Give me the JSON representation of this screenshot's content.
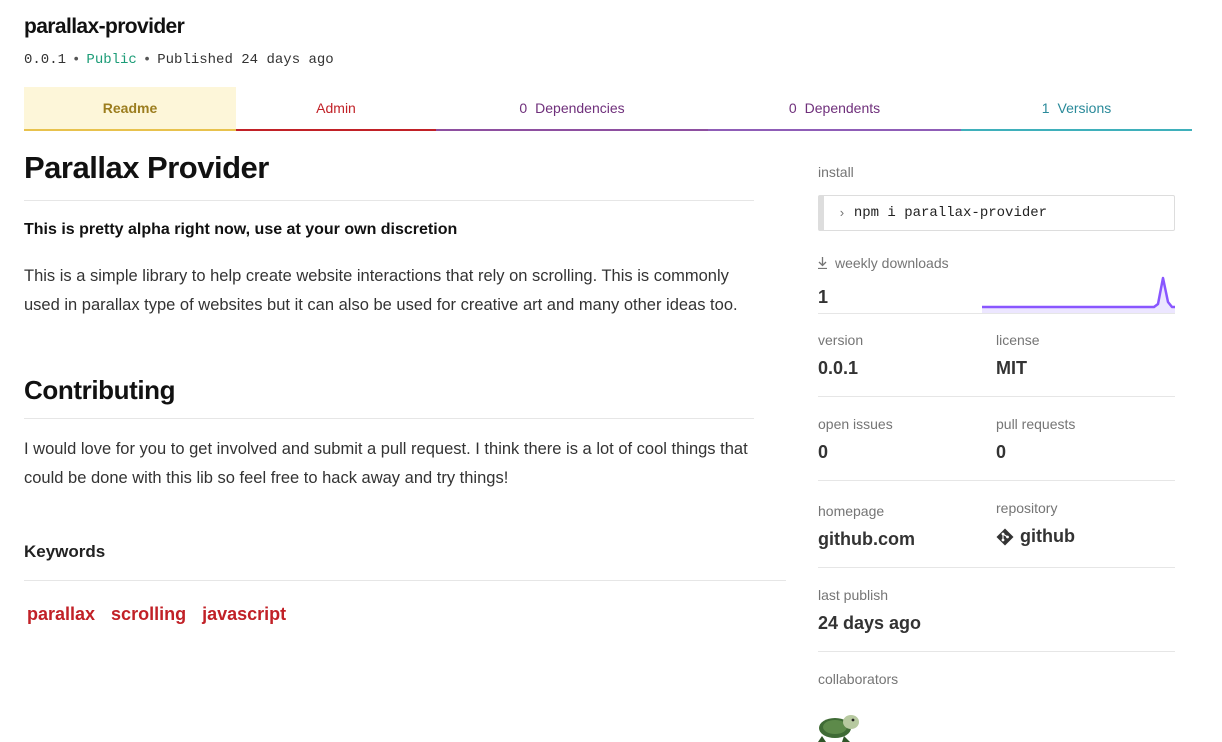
{
  "package": {
    "name": "parallax-provider",
    "version": "0.0.1",
    "visibility": "Public",
    "published_prefix": "Published",
    "published_ago": "24 days ago",
    "separator": "•"
  },
  "tabs": {
    "readme": "Readme",
    "admin": "Admin",
    "dependencies_count": "0",
    "dependencies": "Dependencies",
    "dependents_count": "0",
    "dependents": "Dependents",
    "versions_count": "1",
    "versions": "Versions"
  },
  "readme": {
    "title": "Parallax Provider",
    "notice": "This is pretty alpha right now, use at your own discretion",
    "intro": "This is a simple library to help create website interactions that rely on scrolling. This is commonly used in parallax type of websites but it can also be used for creative art and many other ideas too.",
    "contributing_heading": "Contributing",
    "contributing_text": "I would love for you to get involved and submit a pull request. I think there is a lot of cool things that could be done with this lib so feel free to hack away and try things!"
  },
  "keywords": {
    "heading": "Keywords",
    "items": [
      "parallax",
      "scrolling",
      "javascript"
    ]
  },
  "sidebar": {
    "install_label": "install",
    "install_command": "npm i parallax-provider",
    "weekly_downloads_label": "weekly downloads",
    "weekly_downloads": "1",
    "version_label": "version",
    "version": "0.0.1",
    "license_label": "license",
    "license": "MIT",
    "open_issues_label": "open issues",
    "open_issues": "0",
    "pull_requests_label": "pull requests",
    "pull_requests": "0",
    "homepage_label": "homepage",
    "homepage": "github.com",
    "repository_label": "repository",
    "repository": "github",
    "last_publish_label": "last publish",
    "last_publish": "24 days ago",
    "collaborators_label": "collaborators"
  },
  "colors": {
    "npm_red": "#c12127",
    "public_green": "#1c9c77",
    "sparkline_purple": "#8956ff"
  },
  "icons": {
    "install": "chevron-right-icon",
    "downloads": "download-icon",
    "repository": "git-icon",
    "collaborator": "turtle-avatar"
  }
}
